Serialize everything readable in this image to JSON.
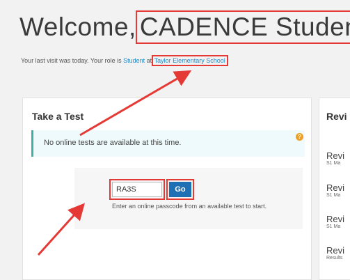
{
  "header": {
    "welcome_prefix": "Welcome,",
    "user_name": "CADENCE Student",
    "last_visit_text": "Your last visit was today. Your role is",
    "role_link": "Student",
    "at_text": "at",
    "school_link": "Taylor Elementary School"
  },
  "take_test": {
    "title": "Take a Test",
    "alert_text": "No online tests are available at this time.",
    "help_icon": "?",
    "passcode_value": "RA3S",
    "go_label": "Go",
    "help_text": "Enter an online passcode from an available test to start."
  },
  "review": {
    "title": "Revi",
    "items": [
      {
        "title": "Revi",
        "sub": "S1 Ma"
      },
      {
        "title": "Revi",
        "sub": "S1 Ma"
      },
      {
        "title": "Revi",
        "sub": "S1 Ma"
      },
      {
        "title": "Revi",
        "sub": "Results"
      }
    ]
  },
  "colors": {
    "highlight": "#e53935",
    "link": "#1e88c8",
    "go_button": "#1f6fb5",
    "alert_border": "#3fb0a8"
  }
}
